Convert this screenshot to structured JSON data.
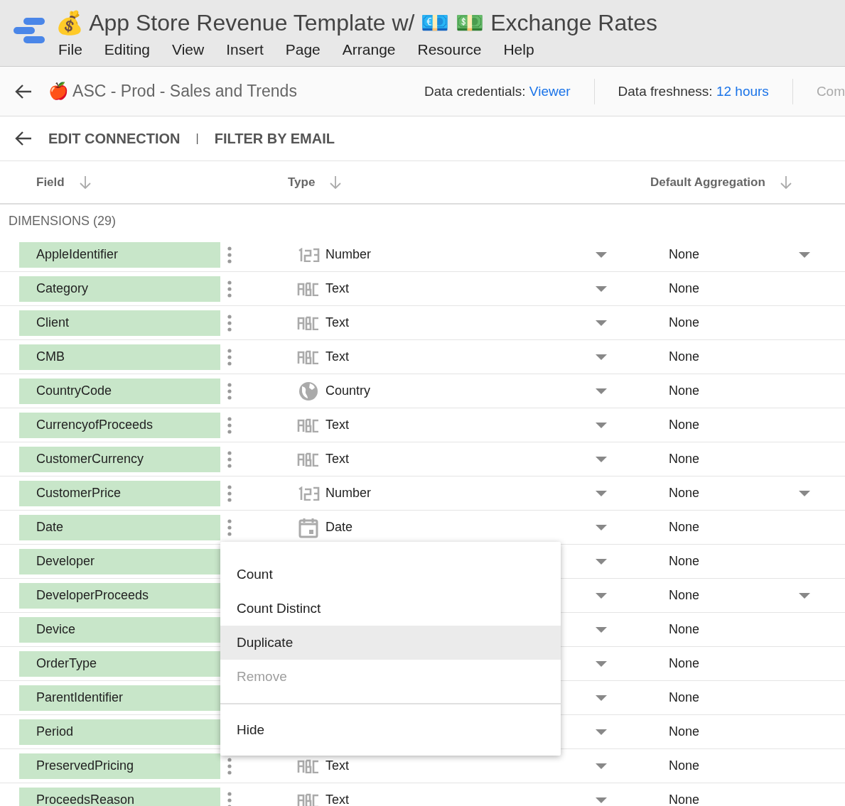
{
  "app": {
    "title": "💰 App Store Revenue Template w/ 💶 💵 Exchange Rates",
    "menu": [
      "File",
      "Editing",
      "View",
      "Insert",
      "Page",
      "Arrange",
      "Resource",
      "Help"
    ]
  },
  "datasource": {
    "name": "🍎 ASC - Prod - Sales and Trends",
    "credentials_label": "Data credentials:",
    "credentials_value": "Viewer",
    "freshness_label": "Data freshness:",
    "freshness_value": "12 hours",
    "extra": "Com"
  },
  "toolbar": {
    "edit": "EDIT CONNECTION",
    "separator": "|",
    "filter": "FILTER BY EMAIL"
  },
  "columns": [
    "Field",
    "Type",
    "Default Aggregation"
  ],
  "section": "DIMENSIONS (29)",
  "rows": [
    {
      "field": "AppleIdentifier",
      "kind": "number",
      "type": "Number",
      "aggregation": "None",
      "agg_menu": true
    },
    {
      "field": "Category",
      "kind": "text",
      "type": "Text",
      "aggregation": "None",
      "agg_menu": false
    },
    {
      "field": "Client",
      "kind": "text",
      "type": "Text",
      "aggregation": "None",
      "agg_menu": false
    },
    {
      "field": "CMB",
      "kind": "text",
      "type": "Text",
      "aggregation": "None",
      "agg_menu": false
    },
    {
      "field": "CountryCode",
      "kind": "country",
      "type": "Country",
      "aggregation": "None",
      "agg_menu": false
    },
    {
      "field": "CurrencyofProceeds",
      "kind": "text",
      "type": "Text",
      "aggregation": "None",
      "agg_menu": false
    },
    {
      "field": "CustomerCurrency",
      "kind": "text",
      "type": "Text",
      "aggregation": "None",
      "agg_menu": false
    },
    {
      "field": "CustomerPrice",
      "kind": "number",
      "type": "Number",
      "aggregation": "None",
      "agg_menu": true
    },
    {
      "field": "Date",
      "kind": "date",
      "type": "Date",
      "aggregation": "None",
      "agg_menu": false
    },
    {
      "field": "Developer",
      "kind": "hidden",
      "aggregation": "None",
      "agg_menu": false
    },
    {
      "field": "DeveloperProceeds",
      "kind": "hidden",
      "aggregation": "None",
      "agg_menu": true
    },
    {
      "field": "Device",
      "kind": "hidden",
      "aggregation": "None",
      "agg_menu": false
    },
    {
      "field": "OrderType",
      "kind": "hidden",
      "aggregation": "None",
      "agg_menu": false
    },
    {
      "field": "ParentIdentifier",
      "kind": "hidden",
      "aggregation": "None",
      "agg_menu": false
    },
    {
      "field": "Period",
      "kind": "hidden",
      "aggregation": "None",
      "agg_menu": false
    },
    {
      "field": "PreservedPricing",
      "kind": "text",
      "type": "Text",
      "aggregation": "None",
      "agg_menu": false
    },
    {
      "field": "ProceedsReason",
      "kind": "text",
      "type": "Text",
      "aggregation": "None",
      "agg_menu": false
    }
  ],
  "context_menu": {
    "items": [
      {
        "label": "Count",
        "selected": false,
        "disabled": false
      },
      {
        "label": "Count Distinct",
        "selected": false,
        "disabled": false
      },
      {
        "label": "Duplicate",
        "selected": true,
        "disabled": false
      },
      {
        "label": "Remove",
        "selected": false,
        "disabled": true
      }
    ],
    "footer": "Hide"
  }
}
